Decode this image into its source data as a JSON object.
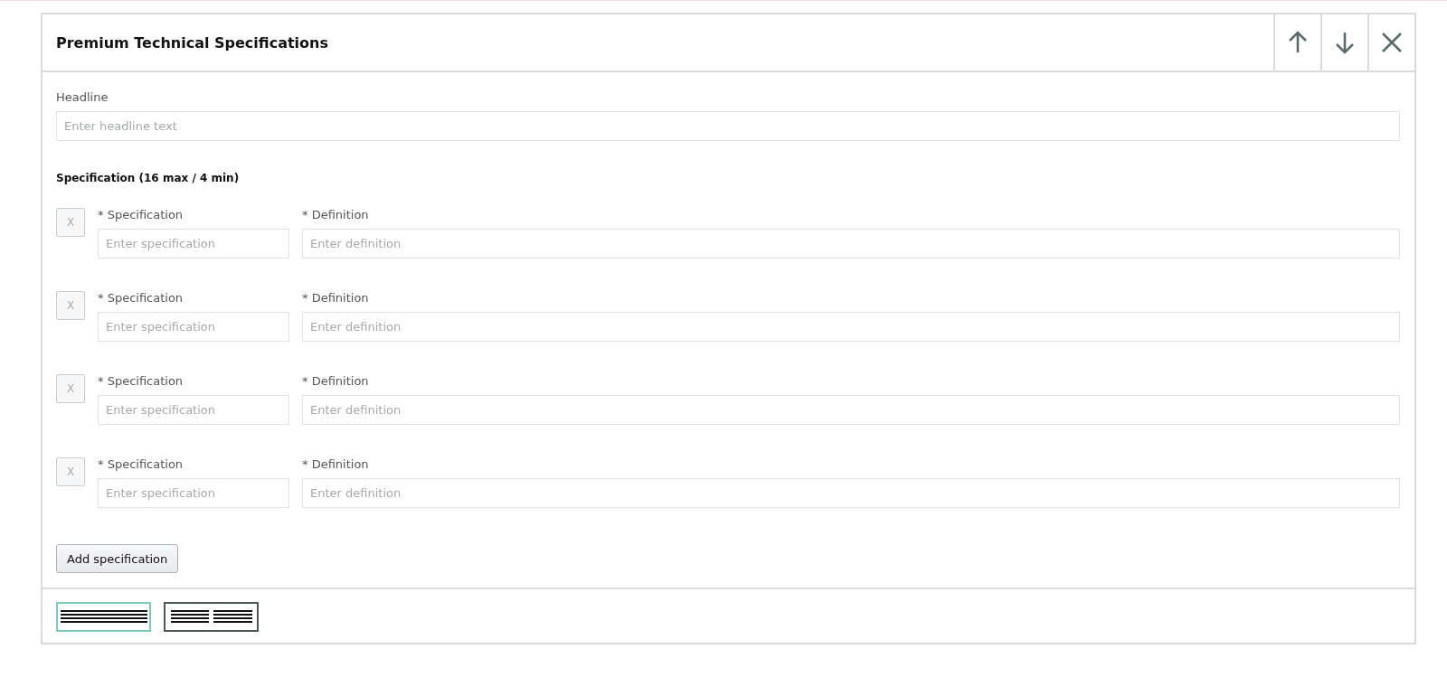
{
  "panel": {
    "title": "Premium Technical Specifications"
  },
  "headline": {
    "label": "Headline",
    "placeholder": "Enter headline text"
  },
  "specifications": {
    "heading": "Specification (16 max / 4 min)",
    "rows": [
      {
        "remove": "X",
        "spec_label": "* Specification",
        "spec_placeholder": "Enter specification",
        "def_label": "* Definition",
        "def_placeholder": "Enter definition"
      },
      {
        "remove": "X",
        "spec_label": "* Specification",
        "spec_placeholder": "Enter specification",
        "def_label": "* Definition",
        "def_placeholder": "Enter definition"
      },
      {
        "remove": "X",
        "spec_label": "* Specification",
        "spec_placeholder": "Enter specification",
        "def_label": "* Definition",
        "def_placeholder": "Enter definition"
      },
      {
        "remove": "X",
        "spec_label": "* Specification",
        "spec_placeholder": "Enter specification",
        "def_label": "* Definition",
        "def_placeholder": "Enter definition"
      }
    ],
    "add_button": "Add specification"
  },
  "layouts": [
    {
      "kind": "single",
      "selected": true
    },
    {
      "kind": "double",
      "selected": false
    }
  ]
}
